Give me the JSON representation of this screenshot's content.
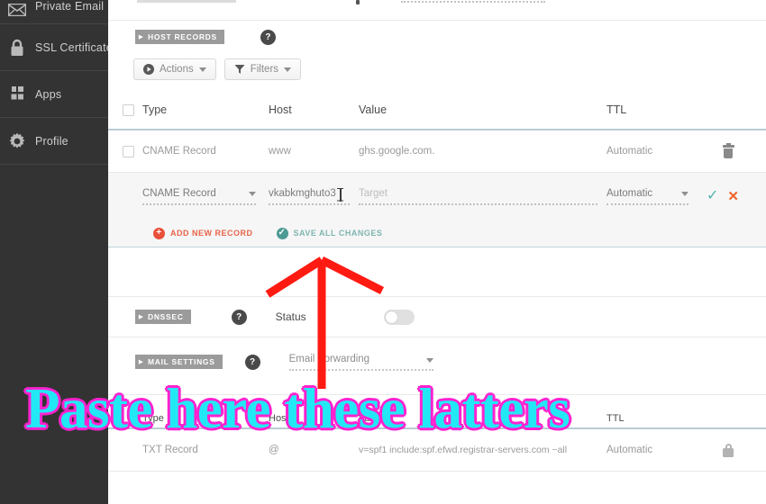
{
  "sidebar": {
    "items": [
      {
        "label": "Private Email",
        "icon": "envelope-icon"
      },
      {
        "label": "SSL Certificates",
        "icon": "lock-icon"
      },
      {
        "label": "Apps",
        "icon": "apps-grid-icon"
      },
      {
        "label": "Profile",
        "icon": "gear-icon"
      }
    ]
  },
  "host_records": {
    "section_tag": "HOST RECORDS",
    "help_label": "?",
    "toolbar": {
      "actions_label": "Actions",
      "filters_label": "Filters"
    },
    "columns": [
      "Type",
      "Host",
      "Value",
      "TTL"
    ],
    "rows": [
      {
        "type": "CNAME Record",
        "host": "www",
        "value": "ghs.google.com.",
        "ttl": "Automatic",
        "action_icon": "trash-icon"
      }
    ],
    "edit_row": {
      "type": "CNAME Record",
      "host_value": "vkabkmghuto3",
      "value_placeholder": "Target",
      "ttl": "Automatic",
      "confirm_icon": "check-icon",
      "cancel_icon": "x-icon"
    },
    "add_new_record_label": "ADD NEW RECORD",
    "save_all_changes_label": "SAVE ALL CHANGES"
  },
  "dnssec": {
    "section_tag": "DNSSEC",
    "help_label": "?",
    "status_label": "Status",
    "toggle_state": "off"
  },
  "mail_settings": {
    "section_tag": "MAIL SETTINGS",
    "help_label": "?",
    "selected_option": "Email Forwarding"
  },
  "mail_records": {
    "columns": [
      "Type",
      "Host",
      "Value",
      "TTL"
    ],
    "rows": [
      {
        "type": "TXT Record",
        "host": "@",
        "value": "v=spf1 include:spf.efwd.registrar-servers.com ~all",
        "ttl": "Automatic",
        "action_icon": "lock-icon"
      }
    ]
  },
  "annotation": {
    "text": "Paste here these latters",
    "text_fill_color": "#22e8f5",
    "text_outline_color": "#ff22d0",
    "arrow_color": "#ff1a12"
  }
}
